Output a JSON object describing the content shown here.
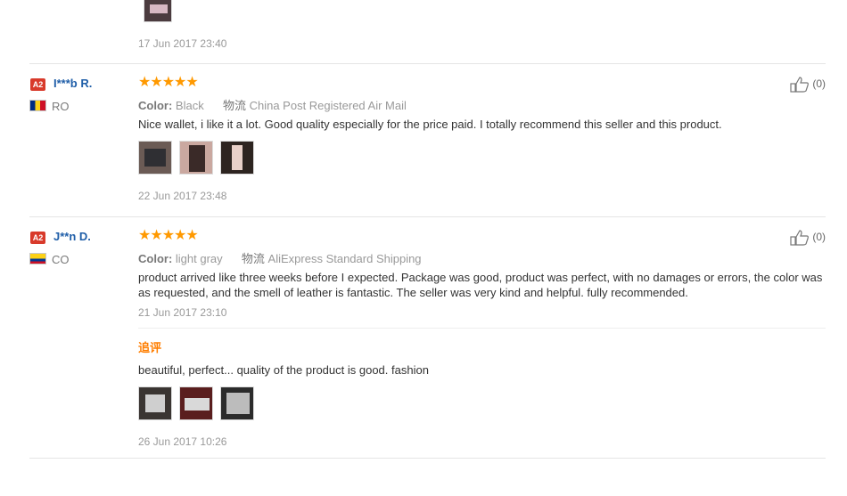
{
  "review0": {
    "date": "17 Jun 2017 23:40"
  },
  "review1": {
    "badge": "A2",
    "username": "I***b R.",
    "country": "RO",
    "stars": "★★★★★",
    "color_label": "Color:",
    "color_value": "Black",
    "shipping_label": "物流",
    "shipping_value": "China Post Registered Air Mail",
    "text": "Nice wallet, i like it a lot. Good quality especially for the price paid. I totally recommend this seller and this product.",
    "date": "22 Jun 2017 23:48",
    "likes": "(0)"
  },
  "review2": {
    "badge": "A2",
    "username": "J**n D.",
    "country": "CO",
    "stars": "★★★★★",
    "color_label": "Color:",
    "color_value": "light gray",
    "shipping_label": "物流",
    "shipping_value": "AliExpress Standard Shipping",
    "text_line1": "product arrived like three weeks before I expected. Package was good, product was perfect, with no damages or errors, the color was",
    "text_line2": "as requested, and the smell of leather is fantastic. The seller was very kind and helpful. fully recommended.",
    "date": "21 Jun 2017 23:10",
    "likes": "(0)",
    "additional_title": "追评",
    "additional_text": "beautiful, perfect... quality of the product is good. fashion",
    "additional_date": "26 Jun 2017 10:26"
  },
  "icons": {
    "thumb": "thumbs-up-icon",
    "star": "star-icon",
    "badge": "level-badge"
  },
  "colors": {
    "username": "#1f5ea8",
    "stars": "#ff9900",
    "badge": "#d83a2b",
    "additional_title": "#ff7e00",
    "meta": "#999999"
  }
}
